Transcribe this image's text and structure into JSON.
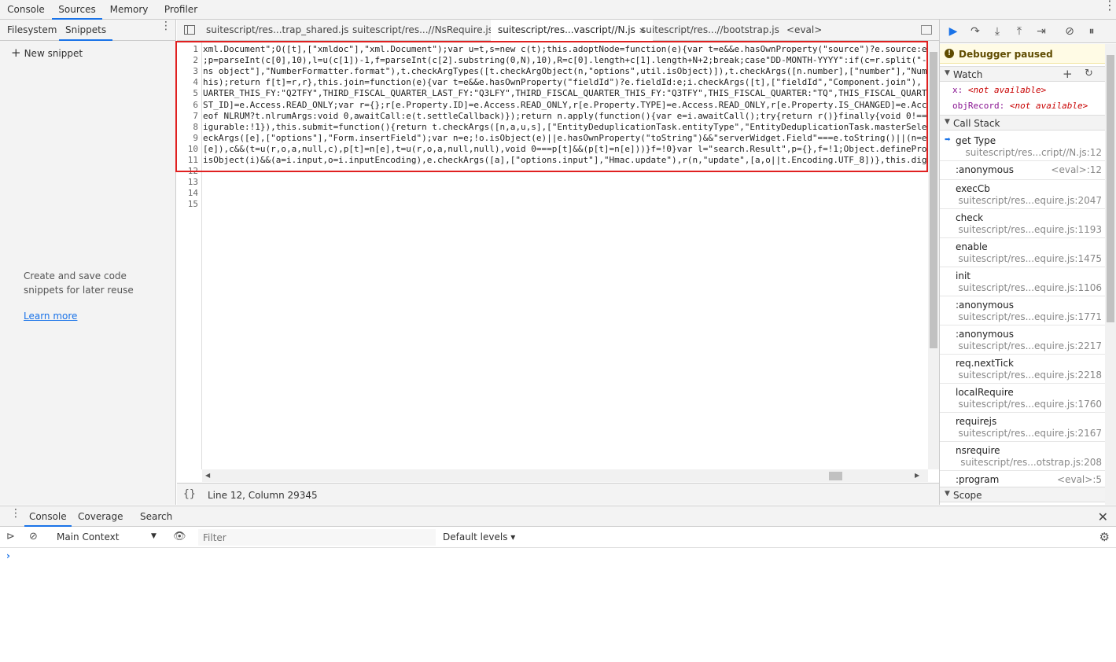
{
  "top_tabs": [
    "Console",
    "Sources",
    "Memory",
    "Profiler"
  ],
  "navigator": {
    "tabs": [
      "Filesystem",
      "Snippets"
    ],
    "new_snippet": "New snippet",
    "empty_text": "Create and save code snippets for later reuse",
    "learn_more": "Learn more"
  },
  "editor": {
    "tabs": [
      {
        "label": "suitescript/res...trap_shared.js"
      },
      {
        "label": "suitescript/res...//NsRequire.js"
      },
      {
        "label": "suitescript/res...vascript//N.js",
        "close": "×"
      },
      {
        "label": "suitescript/res...//bootstrap.js"
      },
      {
        "label": "<eval>"
      }
    ],
    "line_numbers": [
      "1",
      "2",
      "3",
      "4",
      "5",
      "6",
      "7",
      "8",
      "9",
      "10",
      "11",
      "12",
      "13",
      "14",
      "15"
    ],
    "code_lines": [
      "xml.Document\";O([t],[\"xmldoc\"],\"xml.Document\");var u=t,s=new c(t);this.adoptNode=function(e){var t=e&&e.hasOwnProperty(\"source\")?e.source:e;",
      ";p=parseInt(c[0],10),l=u(c[1])-1,f=parseInt(c[2].substring(0,N),10),R=c[0].length+c[1].length+N+2;break;case\"DD-MONTH-YYYY\":if(c=r.split(\"-\"",
      "ns object\"],\"NumberFormatter.format\"),t.checkArgTypes([t.checkArgObject(n,\"options\",util.isObject)]),t.checkArgs([n.number],[\"number\"],\"Numb",
      "his);return f[t]=r,r},this.join=function(e){var t=e&&e.hasOwnProperty(\"fieldId\")?e.fieldId:e;i.checkArgs([t],[\"fieldId\",\"Component.join\"),",
      "UARTER_THIS_FY:\"Q2TFY\",THIRD_FISCAL_QUARTER_LAST_FY:\"Q3LFY\",THIRD_FISCAL_QUARTER_THIS_FY:\"Q3TFY\",THIS_FISCAL_QUARTER:\"TQ\",THIS_FISCAL_QUARTE",
      "ST_ID]=e.Access.READ_ONLY;var r={};r[e.Property.ID]=e.Access.READ_ONLY,r[e.Property.TYPE]=e.Access.READ_ONLY,r[e.Property.IS_CHANGED]=e.Acce",
      "eof NLRUM?t.nlrumArgs:void 0,awaitCall:e(t.settleCallback)});return n.apply(function(){var e=i.awaitCall();try{return r()}finally{void 0!==e",
      "igurable:!1}),this.submit=function(){return t.checkArgs([n,a,u,s],[\"EntityDeduplicationTask.entityType\",\"EntityDeduplicationTask.masterSelec",
      "eckArgs([e],[\"options\"],\"Form.insertField\");var n=e;!o.isObject(e)||e.hasOwnProperty(\"toString\")&&\"serverWidget.Field\"===e.toString()||(n=e",
      "[e]),c&&(t=u(r,o,a,null,c),p[t]=n[e],t=u(r,o,a,null,null),void 0===p[t]&&(p[t]=n[e]))}f=!0}var l=\"search.Result\",p={},f=!1;Object.definePro",
      "isObject(i)&&(a=i.input,o=i.inputEncoding),e.checkArgs([a],[\"options.input\"],\"Hmac.update\"),r(n,\"update\",[a,o||t.Encoding.UTF_8])},this.dige",
      "",
      "",
      "",
      ""
    ],
    "status_pretty": "{}",
    "status_position": "Line 12, Column 29345"
  },
  "debugger": {
    "paused_text": "Debugger paused",
    "watch_label": "Watch",
    "watch": [
      {
        "name": "x",
        "value": "<not available>"
      },
      {
        "name": "objRecord",
        "value": "<not available>"
      }
    ],
    "call_stack_label": "Call Stack",
    "call_stack": [
      {
        "fn": "get Type",
        "loc": "suitescript/res...cript//N.js:12",
        "current": true
      },
      {
        "fn": ":anonymous",
        "loc": "<eval>:12",
        "inline": true
      },
      {
        "fn": "execCb",
        "loc": "suitescript/res...equire.js:2047"
      },
      {
        "fn": "check",
        "loc": "suitescript/res...equire.js:1193"
      },
      {
        "fn": "enable",
        "loc": "suitescript/res...equire.js:1475"
      },
      {
        "fn": "init",
        "loc": "suitescript/res...equire.js:1106"
      },
      {
        "fn": ":anonymous",
        "loc": "suitescript/res...equire.js:1771"
      },
      {
        "fn": ":anonymous",
        "loc": "suitescript/res...equire.js:2217"
      },
      {
        "fn": "req.nextTick",
        "loc": "suitescript/res...equire.js:2218"
      },
      {
        "fn": "localRequire",
        "loc": "suitescript/res...equire.js:1760"
      },
      {
        "fn": "requirejs",
        "loc": "suitescript/res...equire.js:2167"
      },
      {
        "fn": "nsrequire",
        "loc": "suitescript/res...otstrap.js:208"
      },
      {
        "fn": ":program",
        "loc": "<eval>:5",
        "inline": true
      }
    ],
    "scope_label": "Scope"
  },
  "drawer": {
    "tabs": [
      "Console",
      "Coverage",
      "Search"
    ],
    "context": "Main Context",
    "filter_placeholder": "Filter",
    "levels": "Default levels ▾",
    "prompt": "›"
  }
}
